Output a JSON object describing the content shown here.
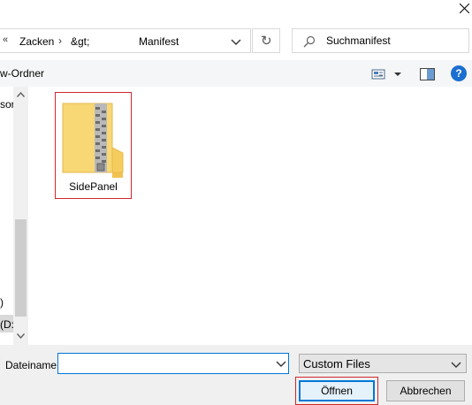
{
  "window": {
    "close_glyph": "close-icon"
  },
  "address": {
    "back_chevrons": "«",
    "crumbs": [
      "Zacken",
      "&gt;",
      "Manifest"
    ],
    "separator": "›"
  },
  "refresh": {
    "glyph": "↻"
  },
  "search": {
    "placeholder": "Suchmanifest"
  },
  "toolbar": {
    "new_folder_label": "w-Ordner",
    "help_label": "?"
  },
  "nav": {
    "items": [
      "sor",
      ")",
      "(D:"
    ]
  },
  "files": [
    {
      "name": "SidePanel",
      "type": "zip-folder"
    }
  ],
  "bottom": {
    "filename_label": "Dateiname:",
    "filename_value": "",
    "filetype_value": "Custom Files",
    "open_label": "Öffnen",
    "cancel_label": "Abbrechen"
  },
  "colors": {
    "accent": "#0078d7",
    "highlight_outline": "#d0272d",
    "folder_yellow": "#f8d775"
  }
}
